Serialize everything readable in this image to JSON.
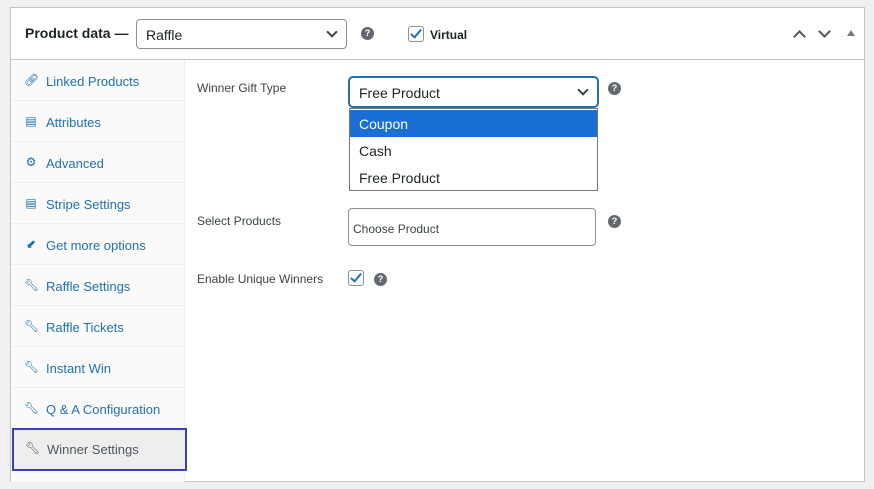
{
  "header": {
    "title": "Product data —",
    "product_type": "Raffle",
    "virtual_label": "Virtual",
    "virtual_checked": true
  },
  "sidebar": {
    "items": [
      {
        "label": "Linked Products",
        "icon": "link-icon"
      },
      {
        "label": "Attributes",
        "icon": "list-icon"
      },
      {
        "label": "Advanced",
        "icon": "gear-icon"
      },
      {
        "label": "Stripe Settings",
        "icon": "card-icon"
      },
      {
        "label": "Get more options",
        "icon": "plug-icon"
      },
      {
        "label": "Raffle Settings",
        "icon": "wrench-icon"
      },
      {
        "label": "Raffle Tickets",
        "icon": "wrench-icon"
      },
      {
        "label": "Instant Win",
        "icon": "wrench-icon"
      },
      {
        "label": "Q & A Configuration",
        "icon": "wrench-icon"
      },
      {
        "label": "Winner Settings",
        "icon": "wrench-icon",
        "active": true
      }
    ]
  },
  "main": {
    "winner_gift_type": {
      "label": "Winner Gift Type",
      "value": "Free Product",
      "options": [
        "Coupon",
        "Cash",
        "Free Product"
      ],
      "highlighted": "Coupon"
    },
    "select_products": {
      "label": "Select Products",
      "placeholder": "Choose Product"
    },
    "unique_winners": {
      "label": "Enable Unique Winners",
      "checked": true
    }
  },
  "colors": {
    "accent": "#2271b1",
    "highlight": "#1a6fd6",
    "active_outline": "#3b3fbd"
  }
}
